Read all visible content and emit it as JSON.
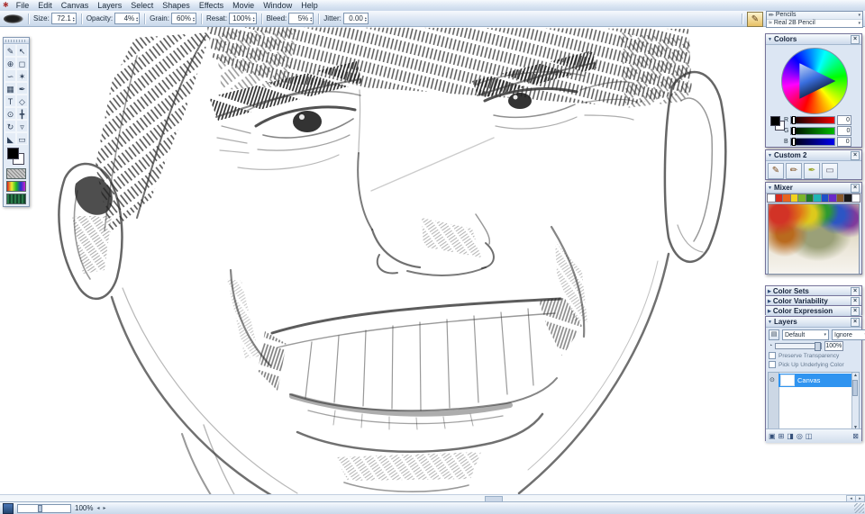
{
  "icons": {
    "app": "✱",
    "collapse": "▼",
    "expand": "▶",
    "close": "×",
    "dropdown": "▾",
    "spin_up": "▴",
    "spin_down": "▾",
    "eye": "⊙",
    "scroll_up": "▲",
    "scroll_down": "▼",
    "scroll_left": "◂",
    "scroll_right": "▸",
    "brush_ghost": "✎",
    "category_icon": "✏",
    "variant_icon": "≈",
    "commands_icon": "▤",
    "opacity_icon": "◔"
  },
  "menu_bar": {
    "items": [
      "File",
      "Edit",
      "Canvas",
      "Layers",
      "Select",
      "Shapes",
      "Effects",
      "Movie",
      "Window",
      "Help"
    ]
  },
  "property_bar": {
    "fields": [
      {
        "label": "Size:",
        "value": "72.1"
      },
      {
        "label": "Opacity:",
        "value": "4%"
      },
      {
        "label": "Grain:",
        "value": "60%"
      },
      {
        "label": "Resat:",
        "value": "100%"
      },
      {
        "label": "Bleed:",
        "value": "5%"
      },
      {
        "label": "Jitter:",
        "value": "0.00"
      }
    ]
  },
  "brush_selector": {
    "category": "Pencils",
    "variant": "Real 2B Pencil"
  },
  "toolbox": {
    "tools": [
      {
        "name": "brush-tool",
        "glyph": "✎"
      },
      {
        "name": "layer-adjuster-tool",
        "glyph": "↖"
      },
      {
        "name": "cloner-tool",
        "glyph": "⊕"
      },
      {
        "name": "rect-select-tool",
        "glyph": "◻"
      },
      {
        "name": "lasso-tool",
        "glyph": "∽"
      },
      {
        "name": "magic-wand-tool",
        "glyph": "✶"
      },
      {
        "name": "crop-tool",
        "glyph": "▦"
      },
      {
        "name": "pen-tool",
        "glyph": "✒"
      },
      {
        "name": "text-tool",
        "glyph": "T"
      },
      {
        "name": "shape-tool",
        "glyph": "◇"
      },
      {
        "name": "zoom-tool",
        "glyph": "⊙"
      },
      {
        "name": "grabber-tool",
        "glyph": "╋"
      },
      {
        "name": "rotate-page-tool",
        "glyph": "↻"
      },
      {
        "name": "dropper-tool",
        "glyph": "▿"
      },
      {
        "name": "paint-bucket-tool",
        "glyph": "◣"
      },
      {
        "name": "eraser-tool",
        "glyph": "▭"
      }
    ]
  },
  "panels": {
    "colors": {
      "title": "Colors",
      "sliders": [
        {
          "label": "R",
          "value": "0"
        },
        {
          "label": "G",
          "value": "0"
        },
        {
          "label": "B",
          "value": "0"
        }
      ]
    },
    "custom": {
      "title": "Custom  2",
      "icons": [
        {
          "name": "custom-brush-1",
          "glyph": "✎"
        },
        {
          "name": "custom-brush-2",
          "glyph": "✏"
        },
        {
          "name": "custom-brush-3",
          "glyph": "✒"
        },
        {
          "name": "custom-brush-4",
          "glyph": "▭"
        }
      ]
    },
    "mixer": {
      "title": "Mixer",
      "swatches": [
        "#ffffff",
        "#d92b1f",
        "#e8641f",
        "#f2d21f",
        "#7ab52a",
        "#1f7a2a",
        "#1fb5b5",
        "#1f50c8",
        "#6a2ac8",
        "#8a5a2a",
        "#1a1a1a",
        "#ffffff"
      ]
    },
    "collapsed": [
      {
        "title": "Color Sets"
      },
      {
        "title": "Color Variability"
      },
      {
        "title": "Color Expression"
      }
    ],
    "layers": {
      "title": "Layers",
      "composite_method": "Default",
      "composite_depth": "Ignore",
      "opacity": "100%",
      "preserve_label": "Preserve Transparency",
      "pickup_label": "Pick Up Underlying Color",
      "items": [
        {
          "name": "Canvas"
        }
      ],
      "buttons": [
        {
          "name": "new-layer-button",
          "glyph": "▣"
        },
        {
          "name": "new-group-button",
          "glyph": "⊞"
        },
        {
          "name": "layer-mask-button",
          "glyph": "◨"
        },
        {
          "name": "dynamic-plugin-button",
          "glyph": "◎"
        },
        {
          "name": "new-channel-button",
          "glyph": "◫"
        },
        {
          "name": "delete-layer-button",
          "glyph": "⊠"
        }
      ]
    }
  },
  "status_bar": {
    "zoom": "100%"
  }
}
